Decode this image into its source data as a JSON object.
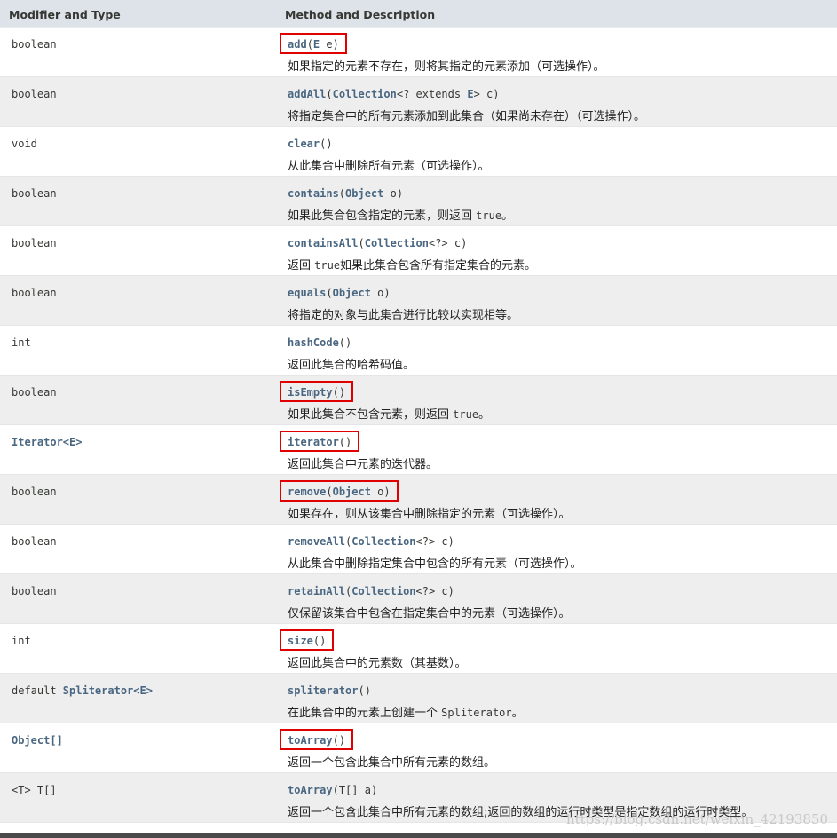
{
  "header": {
    "col1": "Modifier and Type",
    "col2": "Method and Description"
  },
  "rows": [
    {
      "type_prefix": "",
      "type": "boolean",
      "method": "add",
      "params": [
        {
          "t": "E",
          "n": " e"
        }
      ],
      "desc": "如果指定的元素不存在，则将其指定的元素添加（可选操作）。",
      "desc_code": "",
      "desc_tail": "",
      "highlighted": true
    },
    {
      "type_prefix": "",
      "type": "boolean",
      "method": "addAll",
      "params": [
        {
          "t": "Collection",
          "n": "<? extends "
        },
        {
          "t": "E",
          "n": "> c"
        }
      ],
      "desc": "将指定集合中的所有元素添加到此集合（如果尚未存在）（可选操作）。",
      "desc_code": "",
      "desc_tail": "",
      "highlighted": false
    },
    {
      "type_prefix": "",
      "type": "void",
      "method": "clear",
      "params": [],
      "desc": "从此集合中删除所有元素（可选操作）。",
      "desc_code": "",
      "desc_tail": "",
      "highlighted": false
    },
    {
      "type_prefix": "",
      "type": "boolean",
      "method": "contains",
      "params": [
        {
          "t": "Object",
          "n": " o"
        }
      ],
      "desc": "如果此集合包含指定的元素，则返回 ",
      "desc_code": "true",
      "desc_tail": "。",
      "highlighted": false
    },
    {
      "type_prefix": "",
      "type": "boolean",
      "method": "containsAll",
      "params": [
        {
          "t": "Collection",
          "n": "<?> c"
        }
      ],
      "desc": "返回 ",
      "desc_code": "true",
      "desc_tail": "如果此集合包含所有指定集合的元素。",
      "highlighted": false
    },
    {
      "type_prefix": "",
      "type": "boolean",
      "method": "equals",
      "params": [
        {
          "t": "Object",
          "n": " o"
        }
      ],
      "desc": "将指定的对象与此集合进行比较以实现相等。",
      "desc_code": "",
      "desc_tail": "",
      "highlighted": false
    },
    {
      "type_prefix": "",
      "type": "int",
      "method": "hashCode",
      "params": [],
      "desc": "返回此集合的哈希码值。",
      "desc_code": "",
      "desc_tail": "",
      "highlighted": false
    },
    {
      "type_prefix": "",
      "type": "boolean",
      "method": "isEmpty",
      "params": [],
      "desc": "如果此集合不包含元素，则返回 ",
      "desc_code": "true",
      "desc_tail": "。",
      "highlighted": true
    },
    {
      "type_prefix": "",
      "type": "Iterator<E>",
      "type_link": true,
      "method": "iterator",
      "params": [],
      "desc": "返回此集合中元素的迭代器。",
      "desc_code": "",
      "desc_tail": "",
      "highlighted": true
    },
    {
      "type_prefix": "",
      "type": "boolean",
      "method": "remove",
      "params": [
        {
          "t": "Object",
          "n": " o"
        }
      ],
      "desc": "如果存在，则从该集合中删除指定的元素（可选操作）。",
      "desc_code": "",
      "desc_tail": "",
      "highlighted": true
    },
    {
      "type_prefix": "",
      "type": "boolean",
      "method": "removeAll",
      "params": [
        {
          "t": "Collection",
          "n": "<?> c"
        }
      ],
      "desc": "从此集合中删除指定集合中包含的所有元素（可选操作）。",
      "desc_code": "",
      "desc_tail": "",
      "highlighted": false
    },
    {
      "type_prefix": "",
      "type": "boolean",
      "method": "retainAll",
      "params": [
        {
          "t": "Collection",
          "n": "<?> c"
        }
      ],
      "desc": "仅保留该集合中包含在指定集合中的元素（可选操作）。",
      "desc_code": "",
      "desc_tail": "",
      "highlighted": false
    },
    {
      "type_prefix": "",
      "type": "int",
      "method": "size",
      "params": [],
      "desc": "返回此集合中的元素数（其基数）。",
      "desc_code": "",
      "desc_tail": "",
      "highlighted": true
    },
    {
      "type_prefix": "default ",
      "type": "Spliterator<E>",
      "type_link": true,
      "method": "spliterator",
      "params": [],
      "desc": "在此集合中的元素上创建一个 ",
      "desc_code": "Spliterator",
      "desc_tail": "。",
      "highlighted": false
    },
    {
      "type_prefix": "",
      "type": "Object[]",
      "type_link": true,
      "method": "toArray",
      "params": [],
      "desc": "返回一个包含此集合中所有元素的数组。",
      "desc_code": "",
      "desc_tail": "",
      "highlighted": true
    },
    {
      "type_prefix": "",
      "type": "<T> T[]",
      "method": "toArray",
      "params": [
        {
          "t": "",
          "n": "T[] a"
        }
      ],
      "desc": "返回一个包含此集合中所有元素的数组;返回的数组的运行时类型是指定数组的运行时类型。",
      "desc_code": "",
      "desc_tail": "",
      "highlighted": false
    }
  ],
  "watermark": "https://blog.csdn.net/weixin_42193850"
}
